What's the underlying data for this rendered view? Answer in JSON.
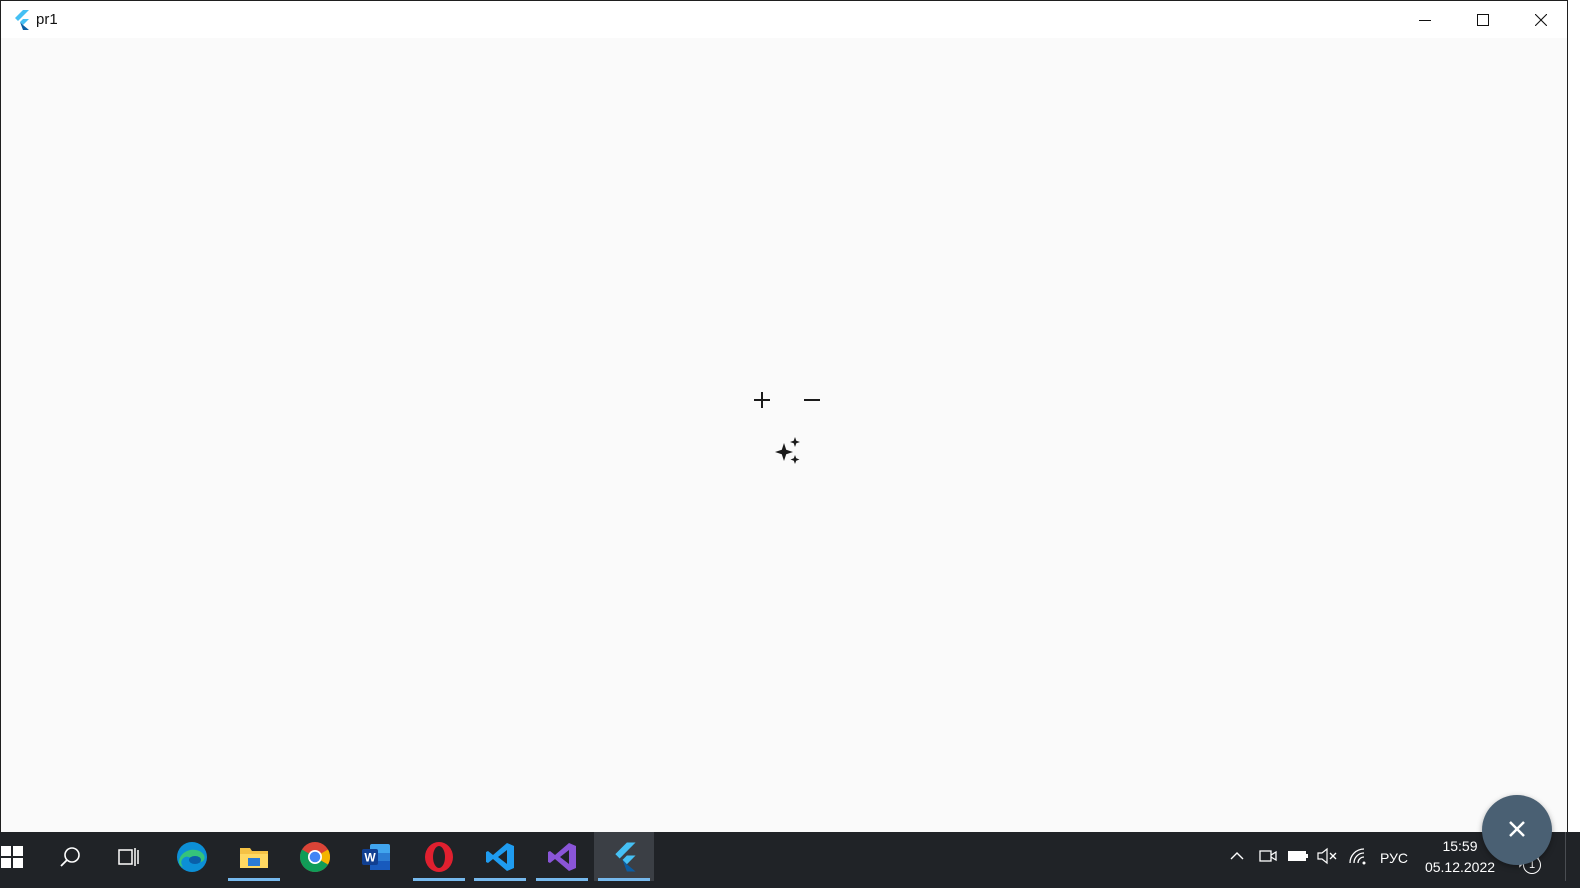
{
  "window": {
    "title": "pr1",
    "controls": [
      "minimize",
      "maximize",
      "close"
    ]
  },
  "content": {
    "icons": [
      "add-icon",
      "remove-icon",
      "auto-awesome-icon"
    ],
    "fab_icon": "close-icon"
  },
  "taskbar": {
    "apps": [
      {
        "name": "start",
        "running": false
      },
      {
        "name": "search",
        "running": false
      },
      {
        "name": "task-view",
        "running": false
      },
      {
        "name": "microsoft-edge",
        "running": false
      },
      {
        "name": "file-explorer",
        "running": true
      },
      {
        "name": "google-chrome",
        "running": false
      },
      {
        "name": "microsoft-word",
        "running": false
      },
      {
        "name": "opera",
        "running": true
      },
      {
        "name": "visual-studio-code",
        "running": true
      },
      {
        "name": "visual-studio",
        "running": true
      },
      {
        "name": "flutter-app",
        "running": true,
        "active": true
      }
    ],
    "tray": {
      "language": "РУС",
      "time": "15:59",
      "date": "05.12.2022",
      "notification_count": "1"
    }
  }
}
